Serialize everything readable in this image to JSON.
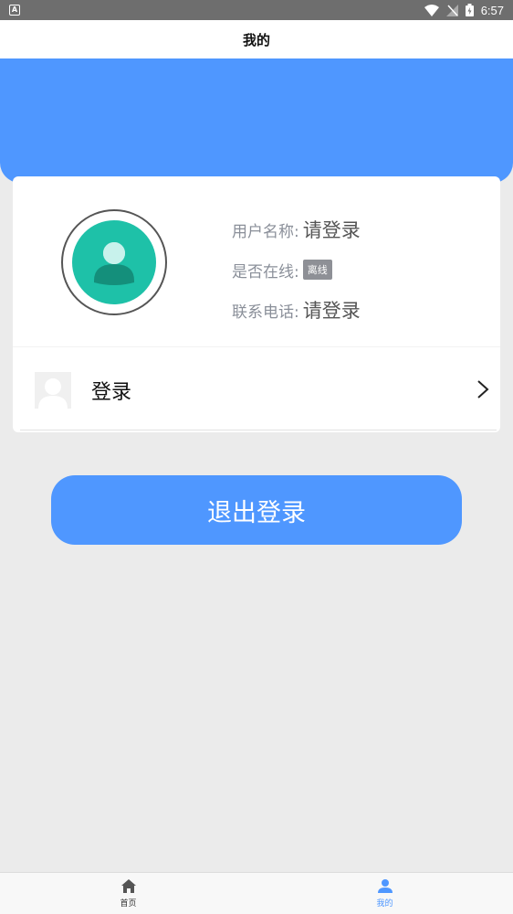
{
  "status_bar": {
    "time": "6:57",
    "notification_letter": "A",
    "icons": [
      "wifi-icon",
      "no-signal-icon",
      "battery-charging-icon"
    ]
  },
  "header": {
    "title": "我的"
  },
  "profile": {
    "username_label": "用户名称:",
    "username_value": "请登录",
    "online_label": "是否在线:",
    "online_badge": "离线",
    "phone_label": "联系电话:",
    "phone_value": "请登录",
    "avatar_icon": "user-avatar-icon"
  },
  "login_item": {
    "label": "登录",
    "icon": "chevron-right-icon"
  },
  "logout_button": {
    "label": "退出登录"
  },
  "bottom_nav": {
    "items": [
      {
        "label": "首页",
        "icon": "home-icon",
        "active": false
      },
      {
        "label": "我的",
        "icon": "person-icon",
        "active": true
      }
    ]
  },
  "colors": {
    "accent": "#4f97ff",
    "avatar": "#1ec1a8",
    "badge": "#8e9096",
    "background": "#ebebeb"
  }
}
